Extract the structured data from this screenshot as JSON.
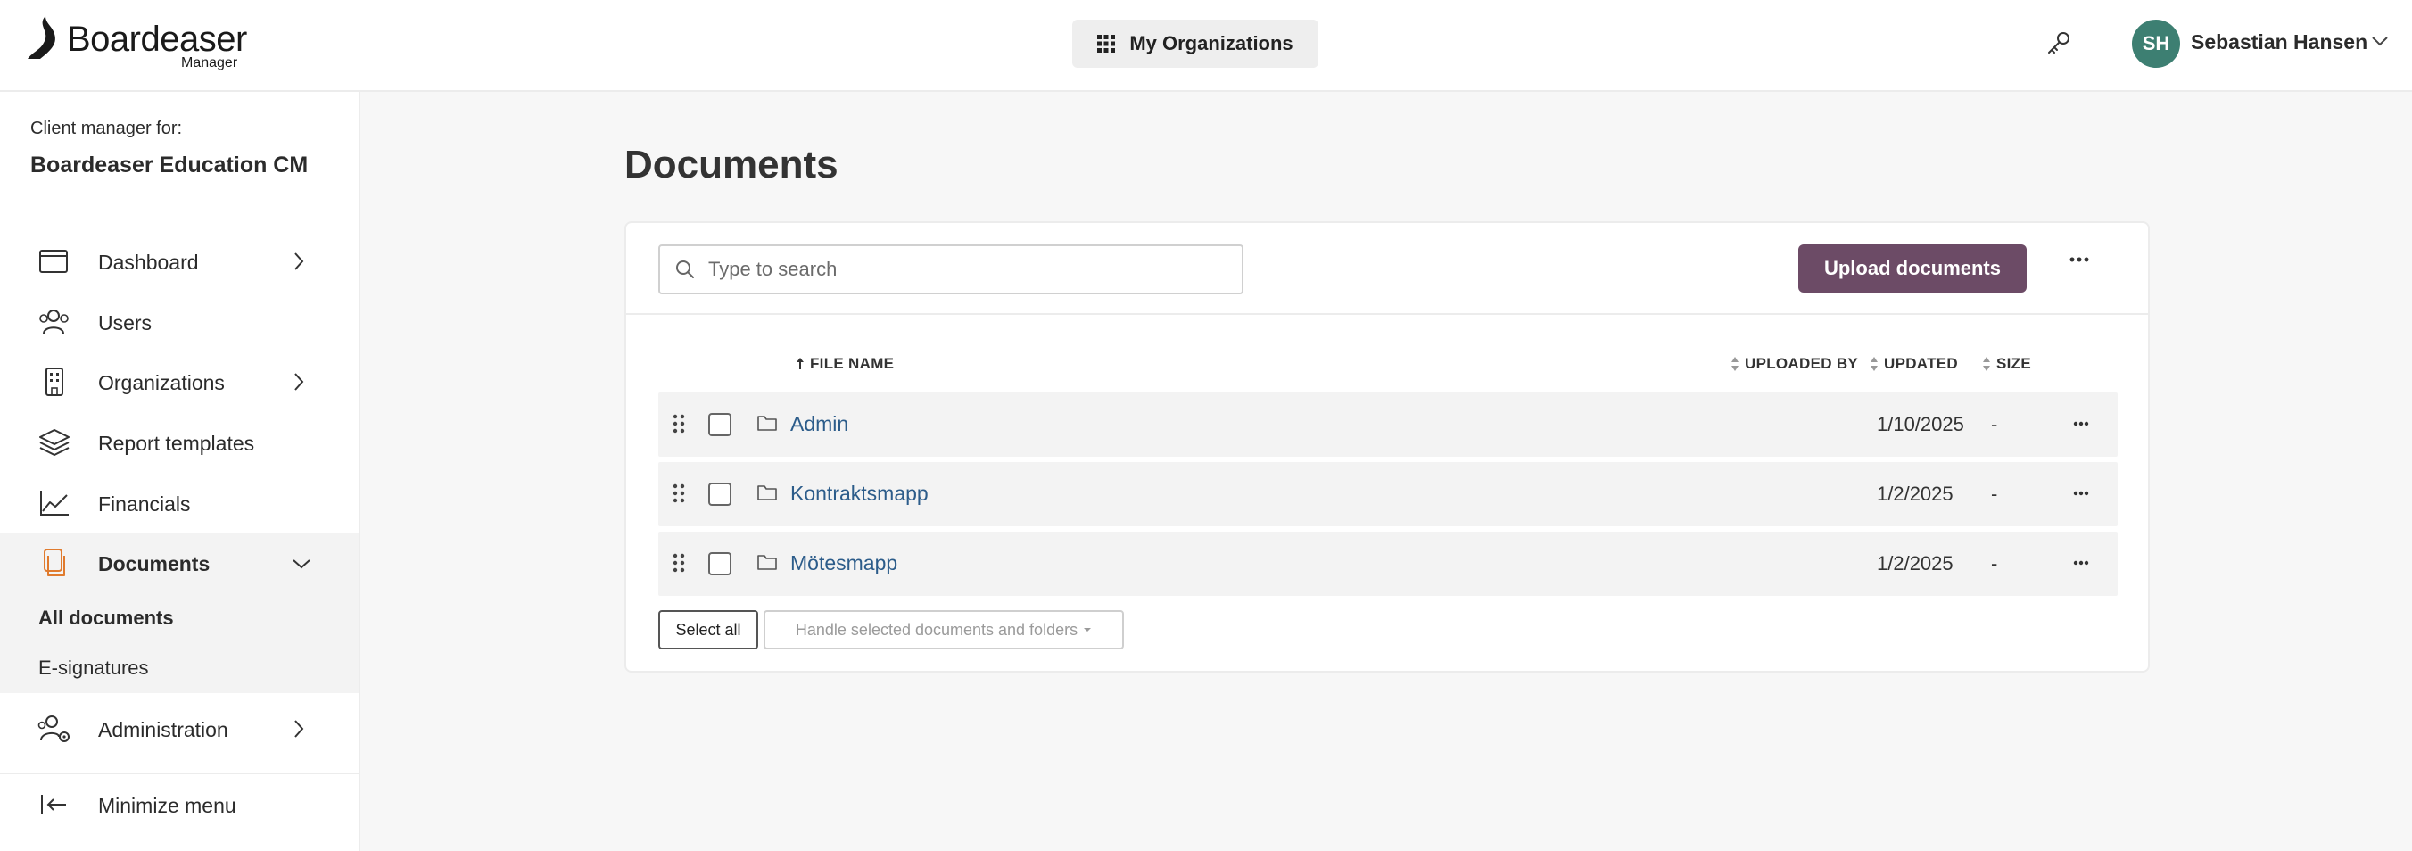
{
  "header": {
    "logo_brand": "Boardeaser",
    "logo_sub": "Manager",
    "org_button_label": "My Organizations",
    "user_initials": "SH",
    "user_name": "Sebastian Hansen"
  },
  "sidebar": {
    "client_label": "Client manager for:",
    "client_name": "Boardeaser Education CM",
    "items": [
      {
        "label": "Dashboard",
        "icon": "calendar-window-icon"
      },
      {
        "label": "Users",
        "icon": "users-icon"
      },
      {
        "label": "Organizations",
        "icon": "building-icon"
      },
      {
        "label": "Report templates",
        "icon": "layers-icon"
      },
      {
        "label": "Financials",
        "icon": "line-chart-icon"
      },
      {
        "label": "Documents",
        "icon": "documents-icon"
      },
      {
        "label": "Administration",
        "icon": "users-gear-icon"
      }
    ],
    "sub_items": [
      {
        "label": "All documents"
      },
      {
        "label": "E-signatures"
      }
    ],
    "minimize_label": "Minimize menu"
  },
  "main": {
    "title": "Documents",
    "search_placeholder": "Type to search",
    "upload_label": "Upload documents",
    "columns": {
      "file_name": "FILE NAME",
      "uploaded_by": "UPLOADED BY",
      "updated": "UPDATED",
      "size": "SIZE"
    },
    "rows": [
      {
        "name": "Admin",
        "uploaded_by": "",
        "updated": "1/10/2025",
        "size": "-"
      },
      {
        "name": "Kontraktsmapp",
        "uploaded_by": "",
        "updated": "1/2/2025",
        "size": "-"
      },
      {
        "name": "Mötesmapp",
        "uploaded_by": "",
        "updated": "1/2/2025",
        "size": "-"
      }
    ],
    "select_all_label": "Select all",
    "handle_selected_label": "Handle selected documents and folders"
  },
  "colors": {
    "accent": "#6c4b66",
    "avatar": "#3d7f72",
    "documents_icon": "#e07b2e",
    "link": "#2c5c8a"
  }
}
